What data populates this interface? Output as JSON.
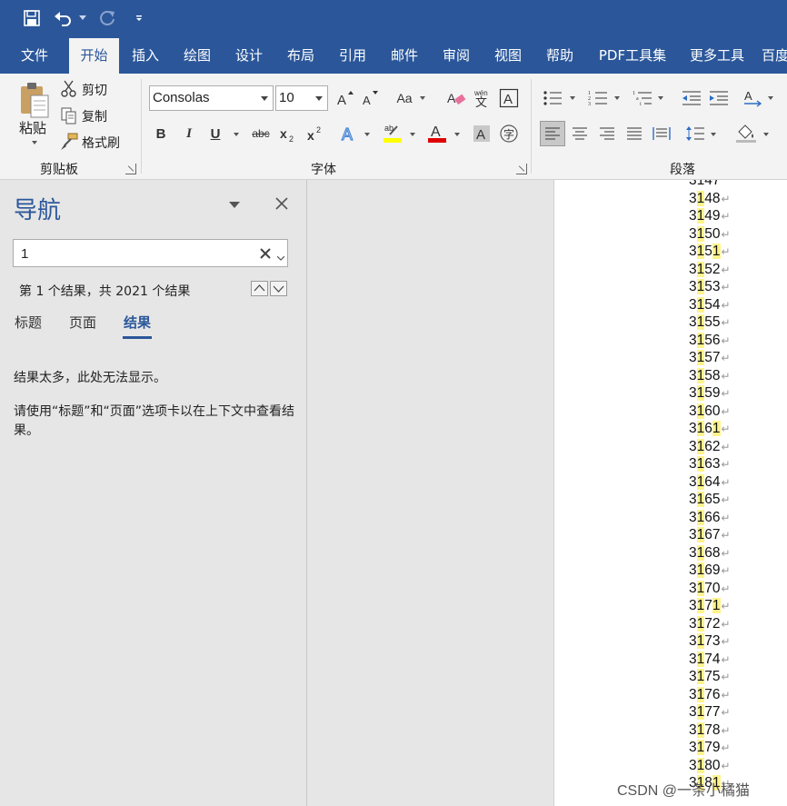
{
  "ribbon_tabs": [
    "文件",
    "开始",
    "插入",
    "绘图",
    "设计",
    "布局",
    "引用",
    "邮件",
    "审阅",
    "视图",
    "帮助",
    "PDF工具集",
    "更多工具",
    "百度"
  ],
  "active_tab": "开始",
  "clipboard": {
    "paste_label": "粘贴",
    "cut_label": "剪切",
    "copy_label": "复制",
    "format_painter_label": "格式刷",
    "group_title": "剪贴板"
  },
  "font": {
    "font_name": "Consolas",
    "font_size": "10",
    "group_title": "字体"
  },
  "paragraph": {
    "group_title": "段落"
  },
  "colors": {
    "accent": "#2b579a",
    "highlight_bar": "#ffff00",
    "font_color_bar": "#e00000",
    "search_highlight": "#fff38a"
  },
  "nav": {
    "title": "导航",
    "search_value": "1",
    "result_count": "第 1 个结果，共 2021 个结果",
    "tabs": [
      "标题",
      "页面",
      "结果"
    ],
    "active_tab": "结果",
    "msg_too_many": "结果太多，此处无法显示。",
    "msg_hint": "请使用“标题”和“页面”选项卡以在上下文中查看结果。"
  },
  "document": {
    "first_line_partial": "3147",
    "lines": [
      "3148",
      "3149",
      "3150",
      "3151",
      "3152",
      "3153",
      "3154",
      "3155",
      "3156",
      "3157",
      "3158",
      "3159",
      "3160",
      "3161",
      "3162",
      "3163",
      "3164",
      "3165",
      "3166",
      "3167",
      "3168",
      "3169",
      "3170",
      "3171",
      "3172",
      "3173",
      "3174",
      "3175",
      "3176",
      "3177",
      "3178",
      "3179",
      "3180",
      "3181"
    ]
  },
  "watermark": "CSDN @一条小橘猫"
}
